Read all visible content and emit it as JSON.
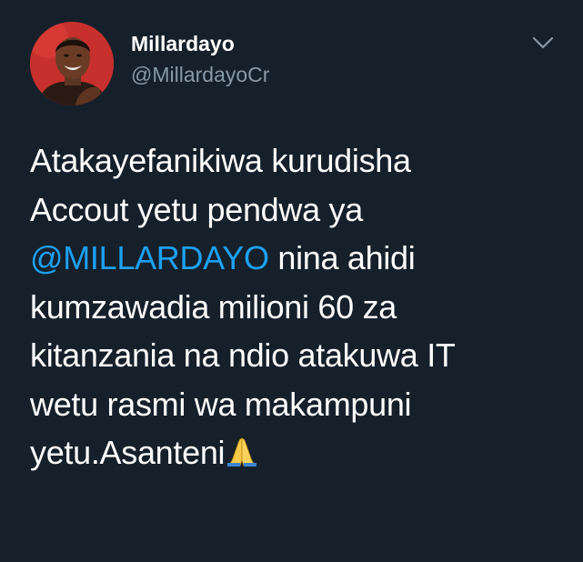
{
  "user": {
    "display_name": "Millardayo",
    "handle": "@MillardayoCr"
  },
  "tweet": {
    "lines": [
      "Atakayefanikiwa kurudisha",
      "Accout yetu pendwa ya",
      {
        "mention": "@MILLARDAYO",
        "rest": " nina ahidi"
      },
      "kumzawadia milioni 60 za",
      "kitanzania na ndio atakuwa IT",
      "wetu rasmi wa makampuni",
      {
        "text": "yetu.Asanteni",
        "emoji": "folded-hands-emoji"
      }
    ]
  },
  "colors": {
    "background": "#15202b",
    "text": "#ffffff",
    "secondary_text": "#8899a6",
    "mention": "#1da1f2"
  },
  "icons": {
    "menu": "chevron-down-icon",
    "avatar": "profile-photo"
  }
}
